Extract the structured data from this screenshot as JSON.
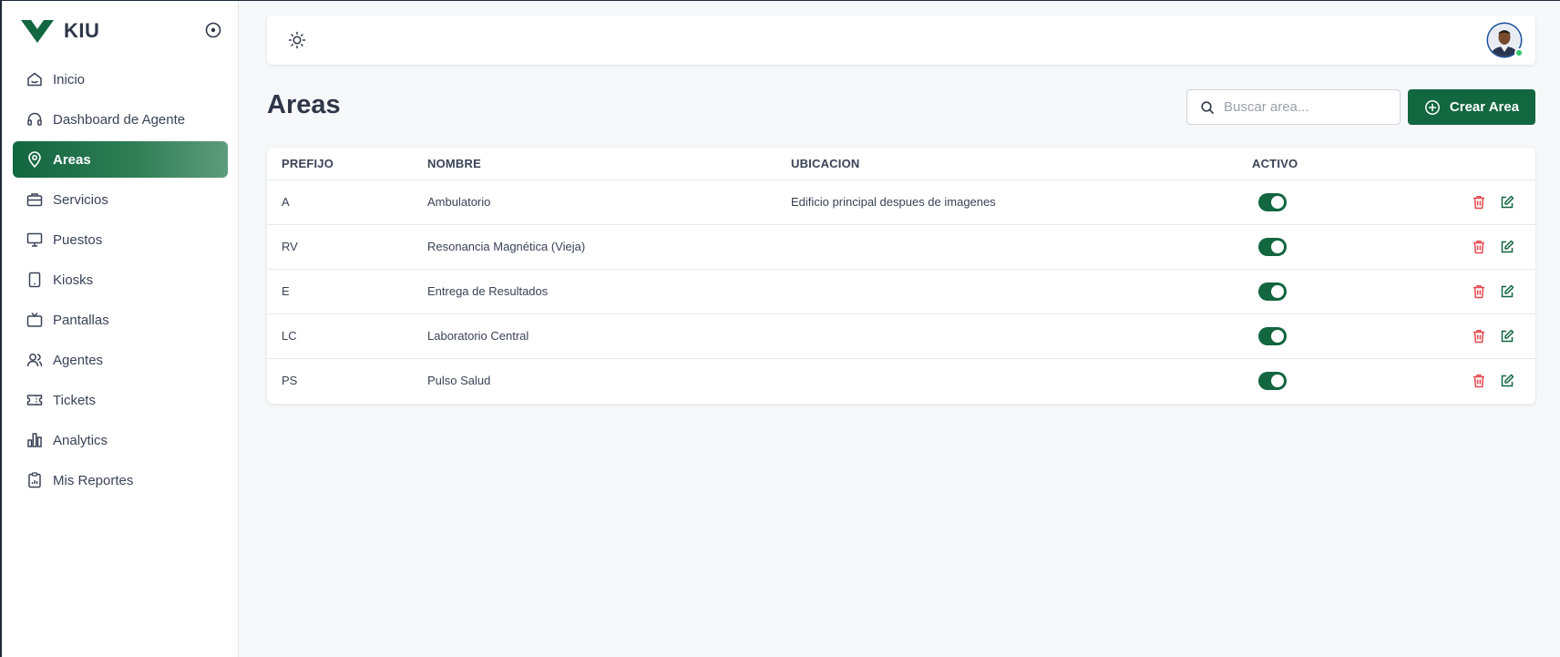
{
  "brand": {
    "name": "KIU",
    "logo_color": "#126640"
  },
  "sidebar": {
    "items": [
      {
        "label": "Inicio",
        "icon": "home-icon",
        "active": false
      },
      {
        "label": "Dashboard de Agente",
        "icon": "headset-icon",
        "active": false
      },
      {
        "label": "Areas",
        "icon": "map-pin-icon",
        "active": true
      },
      {
        "label": "Servicios",
        "icon": "briefcase-icon",
        "active": false
      },
      {
        "label": "Puestos",
        "icon": "monitor-icon",
        "active": false
      },
      {
        "label": "Kiosks",
        "icon": "tablet-icon",
        "active": false
      },
      {
        "label": "Pantallas",
        "icon": "tv-icon",
        "active": false
      },
      {
        "label": "Agentes",
        "icon": "users-icon",
        "active": false
      },
      {
        "label": "Tickets",
        "icon": "ticket-icon",
        "active": false
      },
      {
        "label": "Analytics",
        "icon": "bar-chart-icon",
        "active": false
      },
      {
        "label": "Mis Reportes",
        "icon": "clipboard-icon",
        "active": false
      }
    ]
  },
  "header": {
    "title": "Areas",
    "search_placeholder": "Buscar area...",
    "search_value": "",
    "create_label": "Crear Area"
  },
  "table": {
    "columns": [
      "PREFIJO",
      "NOMBRE",
      "UBICACION",
      "ACTIVO"
    ],
    "rows": [
      {
        "prefijo": "A",
        "nombre": "Ambulatorio",
        "ubicacion": "Edificio principal despues de imagenes",
        "activo": true
      },
      {
        "prefijo": "RV",
        "nombre": "Resonancia Magnética (Vieja)",
        "ubicacion": "",
        "activo": true
      },
      {
        "prefijo": "E",
        "nombre": "Entrega de Resultados",
        "ubicacion": "",
        "activo": true
      },
      {
        "prefijo": "LC",
        "nombre": "Laboratorio Central",
        "ubicacion": "",
        "activo": true
      },
      {
        "prefijo": "PS",
        "nombre": "Pulso Salud",
        "ubicacion": "",
        "activo": true
      }
    ]
  },
  "colors": {
    "accent": "#126640",
    "delete": "#e5484d",
    "online": "#2ec46a"
  }
}
